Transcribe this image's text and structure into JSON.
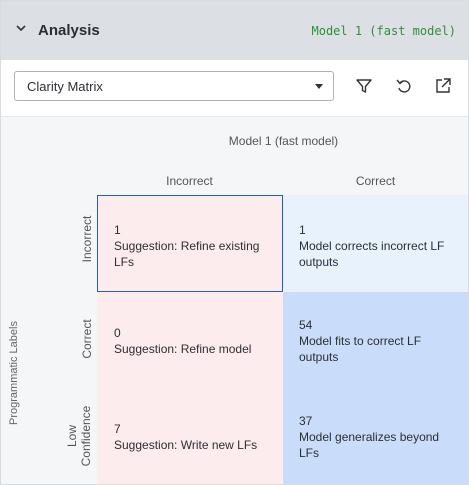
{
  "header": {
    "title": "Analysis",
    "model_badge": "Model 1 (fast model)"
  },
  "toolbar": {
    "selected_view": "Clarity Matrix",
    "icons": [
      "filter-icon",
      "undo-icon",
      "external-link-icon"
    ]
  },
  "matrix": {
    "model_label": "Model 1 (fast model)",
    "columns": [
      "Incorrect",
      "Correct"
    ],
    "y_axis_label": "Programmatic Labels",
    "rows": [
      {
        "label": "Incorrect",
        "cells": [
          {
            "count": "1",
            "text": "Suggestion: Refine existing LFs"
          },
          {
            "count": "1",
            "text": "Model corrects incorrect LF outputs"
          }
        ]
      },
      {
        "label": "Correct",
        "cells": [
          {
            "count": "0",
            "text": "Suggestion: Refine model"
          },
          {
            "count": "54",
            "text": "Model fits to correct LF outputs"
          }
        ]
      },
      {
        "label_line1": "Low",
        "label_line2": "Confidence",
        "cells": [
          {
            "count": "7",
            "text": "Suggestion: Write new LFs"
          },
          {
            "count": "37",
            "text": "Model generalizes beyond LFs"
          }
        ]
      }
    ]
  },
  "colors": {
    "header_bg": "#dce0e4",
    "badge_green": "#2f8f3a",
    "cell_pink": "#fdeced",
    "cell_light_blue": "#e8f2fd",
    "cell_mid_blue": "#c9dcf9",
    "selected_border": "#1f5fbf"
  }
}
